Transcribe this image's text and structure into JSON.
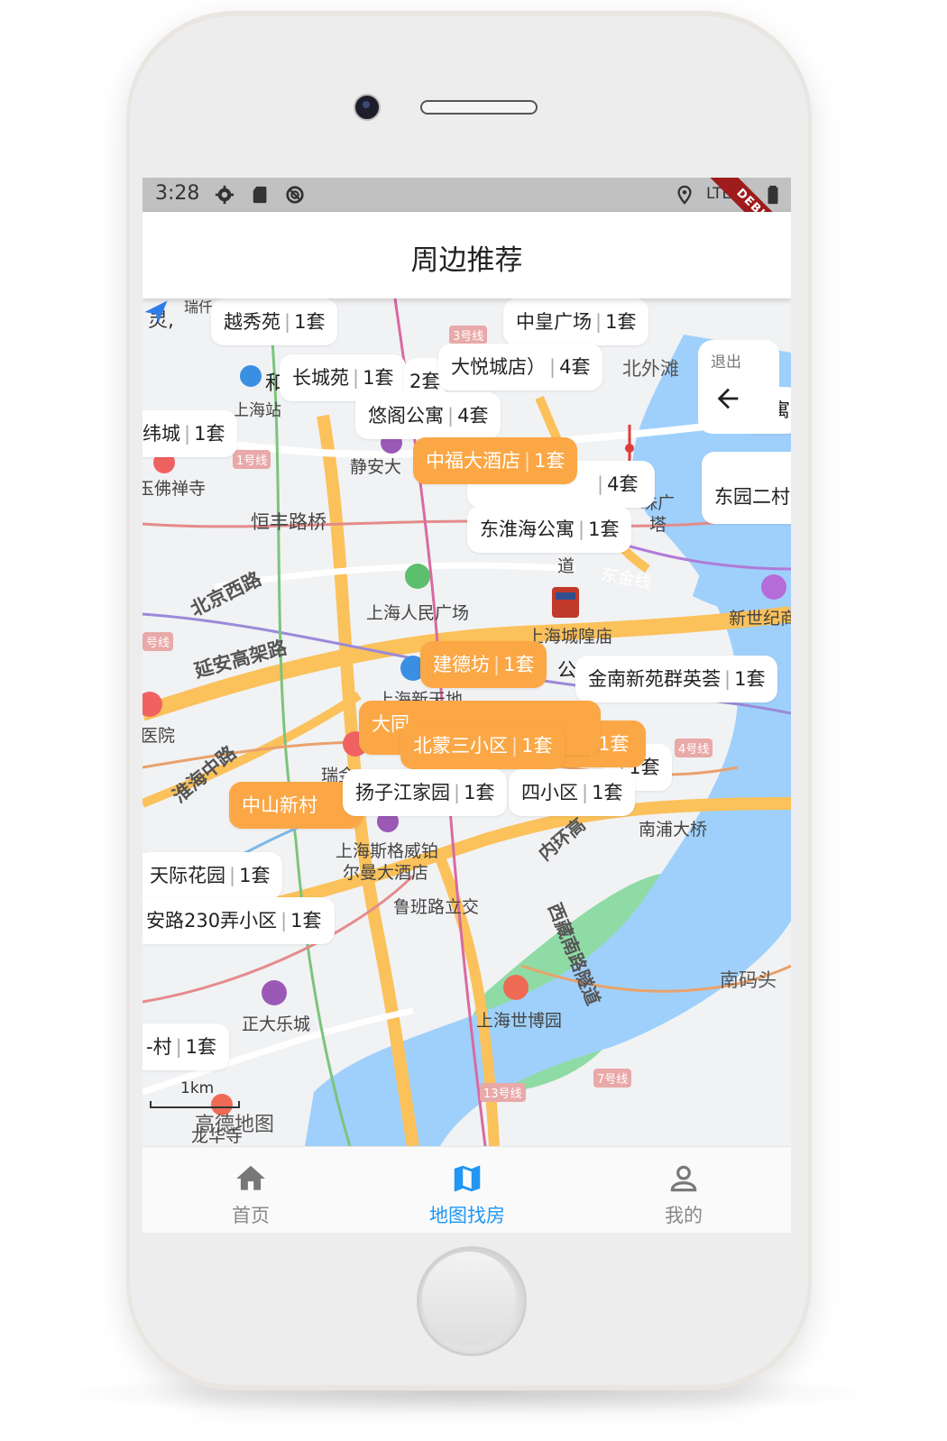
{
  "status_bar": {
    "time": "3:28",
    "network": "LTE",
    "debug_banner": "DEBUG"
  },
  "app_bar": {
    "title": "周边推荐"
  },
  "exit_button": {
    "label": "退出",
    "icon": "arrow-left-icon"
  },
  "map": {
    "labels": {
      "ling": "灵,",
      "ruishi": "瑞仟",
      "shanghai_road": "上海站",
      "jingan": "静安大",
      "fo_temple": "玉佛禅寺",
      "line1": "1号线",
      "hengfeng": "恒丰路桥",
      "beijing_west": "北京西路",
      "yanan": "延安高架路",
      "people_square": "上海人民广场",
      "chenghuang": "上海城隍庙",
      "new_world": "上海新天地",
      "hospital": "医院",
      "huaihai": "淮海中路",
      "ruijin": "瑞金",
      "sheraton1": "上海斯格威铂",
      "sheraton2": "尔曼大酒店",
      "luban": "鲁班路立交",
      "zhengda": "正大乐城",
      "expo": "上海世博园",
      "xizang": "西藏南路隧道",
      "neihuan": "内环高",
      "nanpu": "南浦大桥",
      "nanmatou": "南码头",
      "bund": "北外滩",
      "pearl1": "珠广",
      "pearl2": "塔",
      "century": "新世纪商",
      "dongjin": "东金线",
      "dao": "道",
      "line13": "13号线",
      "line7": "7号线",
      "line4": "4号线",
      "line3": "3号线",
      "hao_line": "号线",
      "he": "和",
      "gong": "公",
      "longhua": "龙华寺"
    },
    "scale": "1km",
    "provider": "高德地图"
  },
  "listings": [
    {
      "name": "越秀苑",
      "count": "1套",
      "highlight": false
    },
    {
      "name": "中皇广场",
      "count": "1套",
      "highlight": false
    },
    {
      "name": "长城苑",
      "count": "1套",
      "highlight": false
    },
    {
      "name": "2套",
      "count": "",
      "highlight": false
    },
    {
      "name": "大悦城店）",
      "count": "4套",
      "highlight": false
    },
    {
      "name": "悠阁公寓",
      "count": "4套",
      "highlight": false
    },
    {
      "name": "纬城",
      "count": "1套",
      "highlight": false
    },
    {
      "name": "中福大酒店",
      "count": "1套",
      "highlight": true
    },
    {
      "name": "",
      "count": "4套",
      "highlight": false
    },
    {
      "name": "东淮海公寓",
      "count": "1套",
      "highlight": false
    },
    {
      "name": "公寓",
      "count": "",
      "highlight": false
    },
    {
      "name": "东园二村",
      "count": "",
      "highlight": false
    },
    {
      "name": "建德坊",
      "count": "1套",
      "highlight": true
    },
    {
      "name": "金南新苑群英荟",
      "count": "1套",
      "highlight": false
    },
    {
      "name": "大同",
      "count": "",
      "highlight": true
    },
    {
      "name": "北蒙三小区",
      "count": "1套",
      "highlight": true
    },
    {
      "name": "",
      "count": "1套",
      "highlight": true
    },
    {
      "name": "",
      "count": "1套",
      "highlight": false
    },
    {
      "name": "中山新村",
      "count": "",
      "highlight": true
    },
    {
      "name": "扬子江家园",
      "count": "1套",
      "highlight": false
    },
    {
      "name": "四小区",
      "count": "1套",
      "highlight": false
    },
    {
      "name": "天际花园",
      "count": "1套",
      "highlight": false
    },
    {
      "name": "安路230弄小区",
      "count": "1套",
      "highlight": false
    },
    {
      "name": "-村",
      "count": "1套",
      "highlight": false
    }
  ],
  "nav": {
    "items": [
      {
        "label": "首页",
        "icon": "home-icon",
        "active": false
      },
      {
        "label": "地图找房",
        "icon": "map-icon",
        "active": true
      },
      {
        "label": "我的",
        "icon": "person-icon",
        "active": false
      }
    ]
  },
  "colors": {
    "accent": "#2196f3",
    "bubble_highlight": "#fba745",
    "river": "#9fd0fb",
    "park": "#8fdba5",
    "road_major": "#fbc15a"
  }
}
